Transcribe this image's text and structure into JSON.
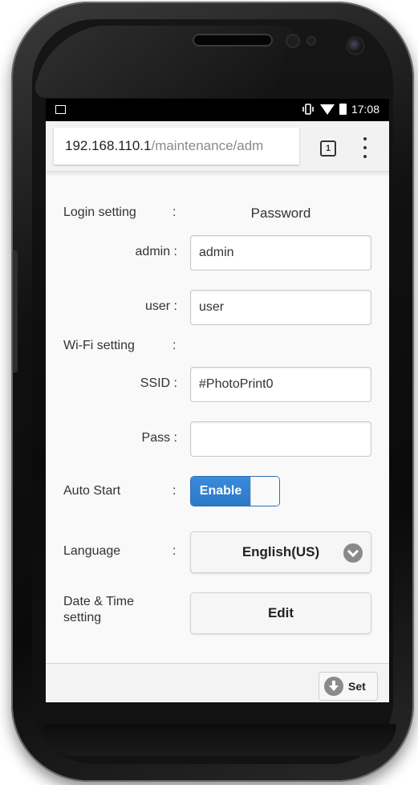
{
  "statusbar": {
    "time": "17:08"
  },
  "browser": {
    "url_host": "192.168.110.1",
    "url_path": "/maintenance/adm",
    "tab_count": "1"
  },
  "form": {
    "login_setting_label": "Login setting",
    "login_colon": ":",
    "password_header": "Password",
    "admin_label": "admin :",
    "admin_value": "admin",
    "user_label": "user :",
    "user_value": "user",
    "wifi_setting_label": "Wi-Fi setting",
    "wifi_colon": ":",
    "ssid_label": "SSID :",
    "ssid_value": "#PhotoPrint0",
    "pass_label": "Pass :",
    "pass_value": "",
    "auto_start_label": "Auto Start",
    "auto_start_colon": ":",
    "auto_start_toggle": "Enable",
    "language_label": "Language",
    "language_colon": ":",
    "language_value": "English(US)",
    "datetime_label_line1": "Date & Time",
    "datetime_label_line2": "setting",
    "edit_button": "Edit"
  },
  "footer": {
    "set_button": "Set"
  },
  "colors": {
    "toggle_accent": "#2c78c6"
  },
  "icons": {
    "status_left": "image-notification-icon",
    "vibrate": "vibrate-icon",
    "wifi": "wifi-icon",
    "battery": "battery-charging-icon",
    "tabs": "tabs-icon",
    "menu": "overflow-menu-icon",
    "dropdown": "chevron-down-icon",
    "set": "download-icon"
  }
}
